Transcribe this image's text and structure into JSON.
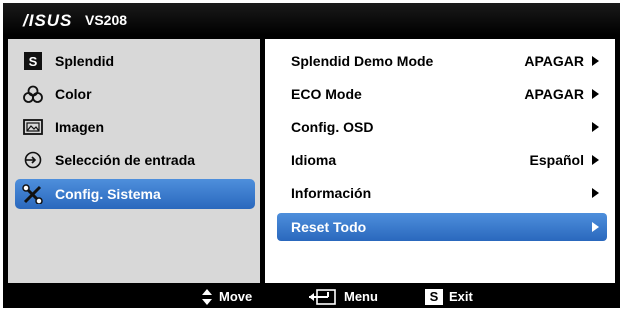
{
  "header": {
    "brand": "/ISUS",
    "model": "VS208"
  },
  "menu": [
    {
      "label": "Splendid",
      "icon": "s-square-icon"
    },
    {
      "label": "Color",
      "icon": "color-circles-icon"
    },
    {
      "label": "Imagen",
      "icon": "image-icon"
    },
    {
      "label": "Selección de entrada",
      "icon": "input-arrow-icon"
    },
    {
      "label": "Config. Sistema",
      "icon": "tools-icon",
      "selected": true
    }
  ],
  "options": [
    {
      "label": "Splendid Demo Mode",
      "value": "APAGAR"
    },
    {
      "label": "ECO Mode",
      "value": "APAGAR"
    },
    {
      "label": "Config. OSD",
      "value": ""
    },
    {
      "label": "Idioma",
      "value": "Español"
    },
    {
      "label": "Información",
      "value": ""
    },
    {
      "label": "Reset Todo",
      "value": "",
      "selected": true
    }
  ],
  "footer": {
    "move": "Move",
    "menu": "Menu",
    "exit": "Exit",
    "exit_key": "S"
  },
  "colors": {
    "highlight": "#3a7bd5",
    "left_panel": "#d8d8d8",
    "frame": "#000000"
  }
}
